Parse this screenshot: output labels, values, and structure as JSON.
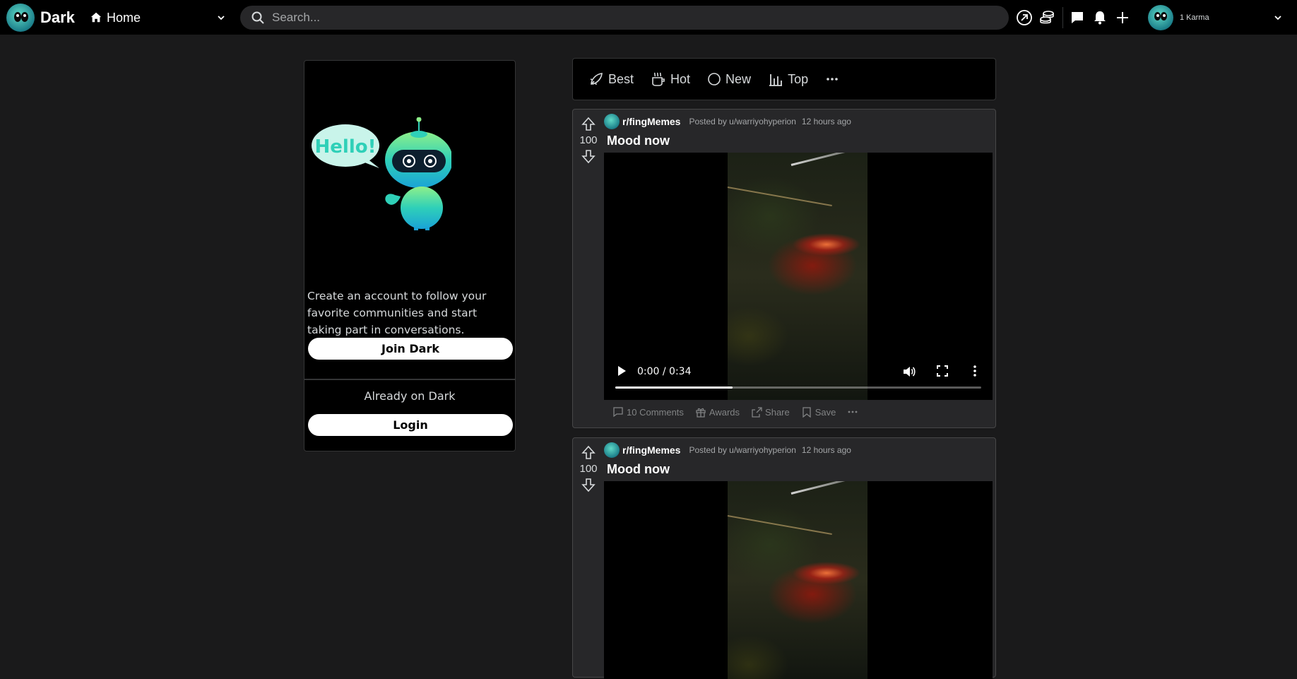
{
  "header": {
    "brand": "Dark",
    "home_label": "Home",
    "search_placeholder": "Search...",
    "karma": "1 Karma",
    "icons": [
      "popular-icon",
      "coins-icon",
      "chat-icon",
      "bell-icon",
      "plus-icon"
    ]
  },
  "signup": {
    "bubble_text": "Hello!",
    "text": "Create an account to follow your favorite communities and start taking part in conversations.",
    "join_label": "Join Dark",
    "already_label": "Already on Dark",
    "login_label": "Login"
  },
  "sortbar": {
    "items": [
      {
        "label": "Best",
        "icon": "rocket-icon"
      },
      {
        "label": "Hot",
        "icon": "hot-cup-icon"
      },
      {
        "label": "New",
        "icon": "new-circle-icon"
      },
      {
        "label": "Top",
        "icon": "bar-chart-icon"
      }
    ],
    "more_icon": "ellipsis-icon"
  },
  "posts": [
    {
      "subreddit": "r/fingMemes",
      "posted_by": "Posted by u/warriyohyperion",
      "time": "12 hours ago",
      "votes": "100",
      "title": "Mood now",
      "video_time": "0:00 / 0:34",
      "progress": 0.32,
      "comments": "10 Comments",
      "awards": "Awards",
      "share": "Share",
      "save": "Save"
    },
    {
      "subreddit": "r/fingMemes",
      "posted_by": "Posted by u/warriyohyperion",
      "time": "12 hours ago",
      "votes": "100",
      "title": "Mood now"
    }
  ],
  "colors": {
    "background": "#1a1a1b",
    "header": "#000000",
    "card": "#272729",
    "accent_teal": "#2fd0b8"
  }
}
